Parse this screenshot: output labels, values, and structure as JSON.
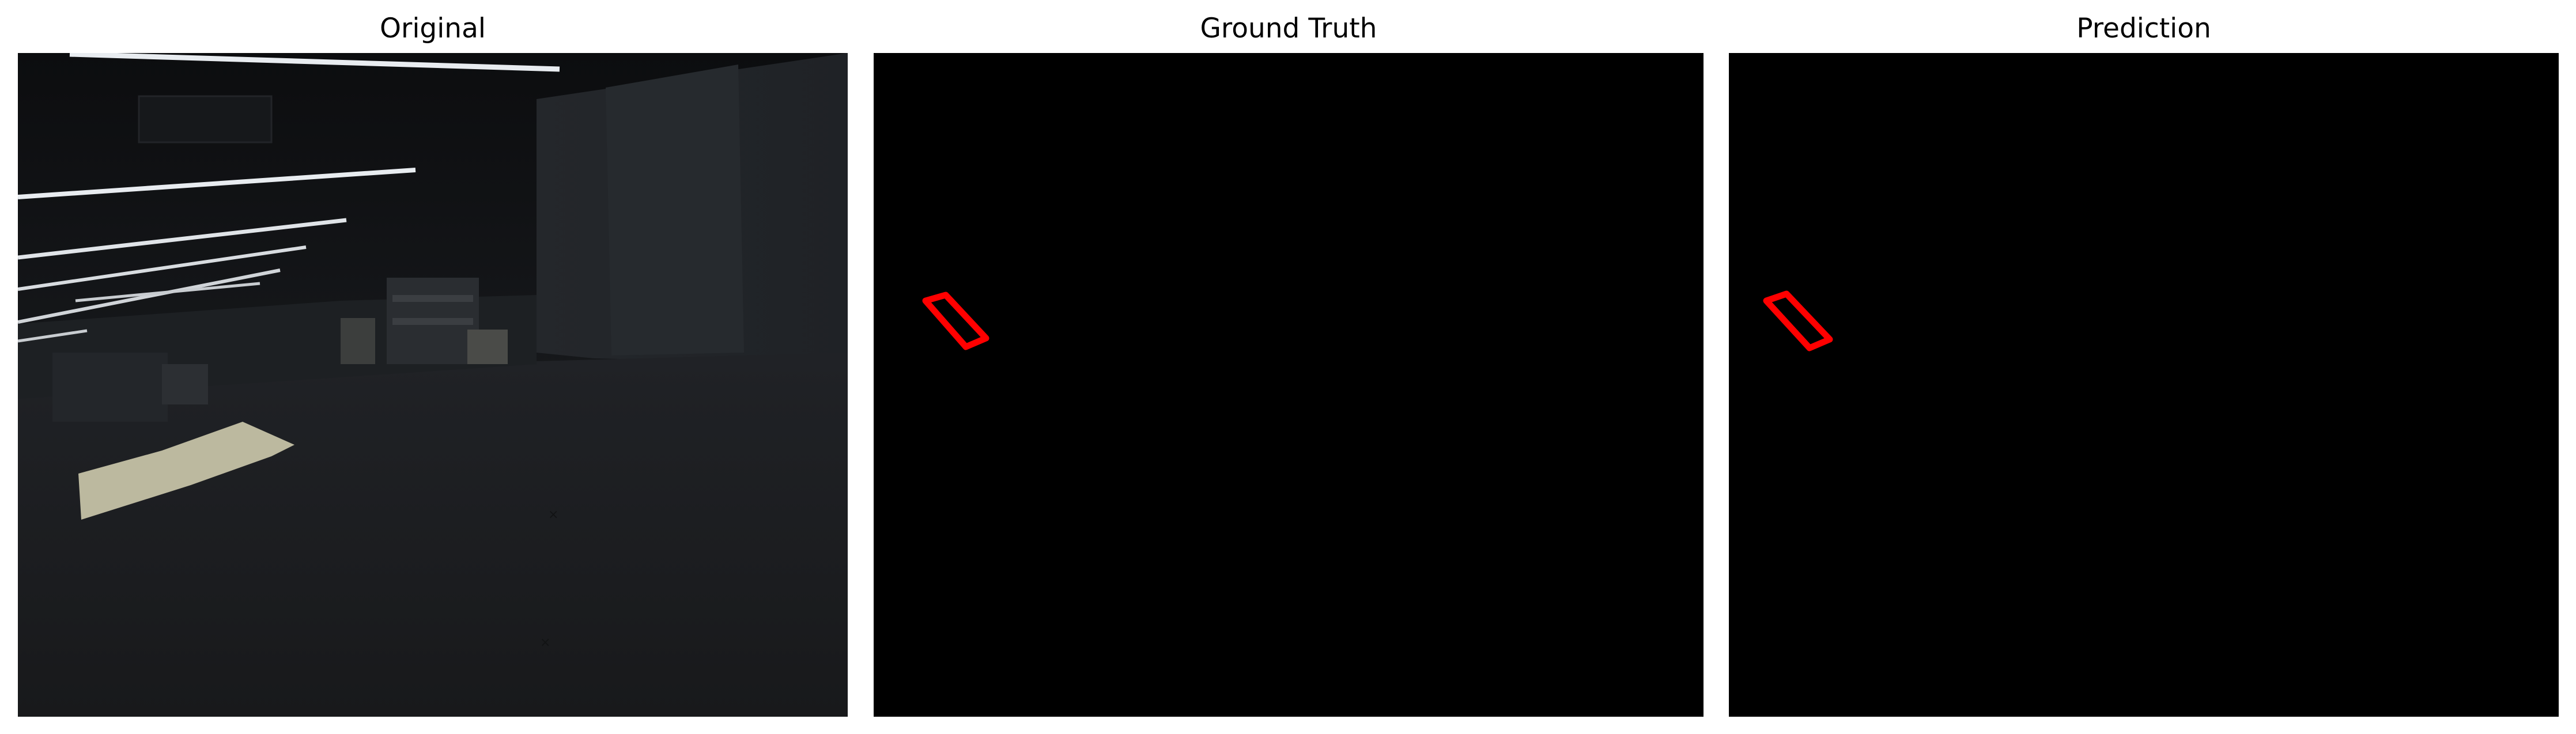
{
  "panels": [
    {
      "id": "original",
      "title": "Original"
    },
    {
      "id": "ground_truth",
      "title": "Ground Truth"
    },
    {
      "id": "prediction",
      "title": "Prediction"
    }
  ],
  "colors": {
    "background": "#ffffff",
    "mask_background": "#000000",
    "mask_outline": "#ff0000",
    "scene_dark": "#1c1e21"
  }
}
